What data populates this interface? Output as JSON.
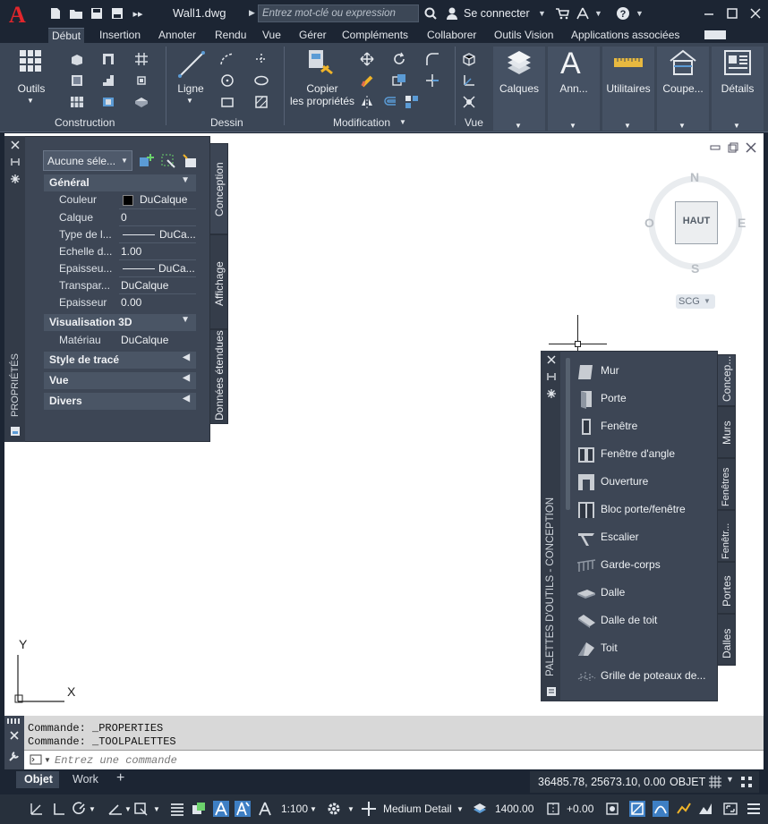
{
  "titlebar": {
    "filename": "Wall1.dwg",
    "search_placeholder": "Entrez mot-clé ou expression",
    "signin": "Se connecter"
  },
  "ribbon_tabs": [
    "Début",
    "Insertion",
    "Annoter",
    "Rendu",
    "Vue",
    "Gérer",
    "Compléments",
    "Collaborer",
    "Outils Vision",
    "Applications associées"
  ],
  "ribbon": {
    "outils": "Outils",
    "ligne": "Ligne",
    "copier_1": "Copier",
    "copier_2": "les propriétés",
    "calques": "Calques",
    "annotation": "Ann...",
    "utilitaires": "Utilitaires",
    "coupe": "Coupe...",
    "details": "Détails",
    "panels": {
      "construction": "Construction",
      "dessin": "Dessin",
      "modification": "Modification",
      "vue": "Vue"
    }
  },
  "viewcube": {
    "n": "N",
    "s": "S",
    "e": "E",
    "o": "O",
    "face": "HAUT",
    "scg": "SCG"
  },
  "properties": {
    "palette_title": "PROPRIÉTÉS",
    "selection": "Aucune séle...",
    "sections": {
      "general": "Général",
      "vis3d": "Visualisation 3D",
      "style": "Style de tracé",
      "vue": "Vue",
      "divers": "Divers"
    },
    "rows": [
      {
        "key": "Couleur",
        "value": "DuCalque"
      },
      {
        "key": "Calque",
        "value": "0"
      },
      {
        "key": "Type de l...",
        "value": "DuCa..."
      },
      {
        "key": "Echelle d...",
        "value": "1.00"
      },
      {
        "key": "Epaisseu...",
        "value": "DuCa..."
      },
      {
        "key": "Transpar...",
        "value": "DuCalque"
      },
      {
        "key": "Epaisseur",
        "value": "0.00"
      }
    ],
    "material": {
      "key": "Matériau",
      "value": "DuCalque"
    },
    "tabs": [
      "Conception",
      "Affichage",
      "Données étendues"
    ]
  },
  "tool_palette": {
    "title": "PALETTES D'OUTILS - CONCEPTION",
    "items": [
      "Mur",
      "Porte",
      "Fenêtre",
      "Fenêtre d'angle",
      "Ouverture",
      "Bloc porte/fenêtre",
      "Escalier",
      "Garde-corps",
      "Dalle",
      "Dalle de toit",
      "Toit",
      "Grille de poteaux de..."
    ],
    "tabs": [
      "Concep...",
      "Murs",
      "Fenêtres",
      "Fenêtr...",
      "Portes",
      "Dalles"
    ]
  },
  "ucs": {
    "y": "Y",
    "x": "X"
  },
  "command": {
    "line1": "Commande:  _PROPERTIES",
    "line2": "Commande:  _TOOLPALETTES",
    "placeholder": "Entrez une commande"
  },
  "layout_tabs": {
    "objet": "Objet",
    "work": "Work"
  },
  "status": {
    "coords": "36485.78, 25673.10, 0.00",
    "mode": "OBJET",
    "scale": "1:100",
    "detail": "Medium Detail",
    "elevation": "1400.00",
    "offset": "+0.00"
  }
}
